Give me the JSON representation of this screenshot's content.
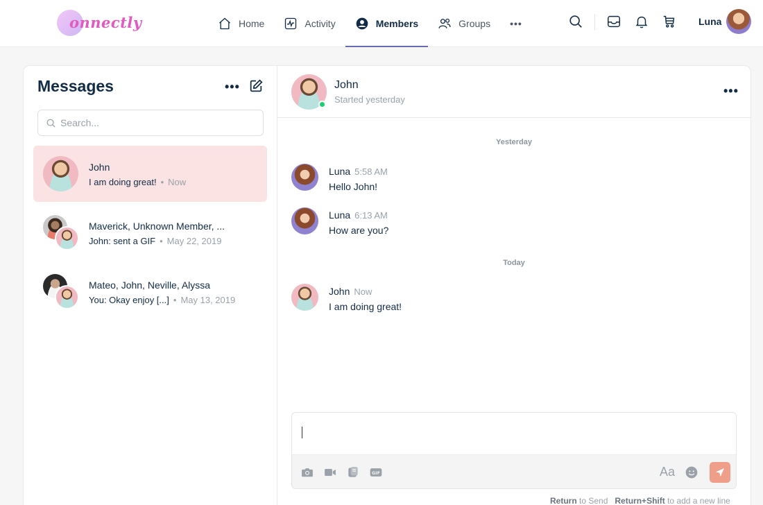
{
  "app": {
    "logo_text": "onnectly"
  },
  "nav": {
    "items": [
      {
        "label": "Home",
        "icon": "home-icon"
      },
      {
        "label": "Activity",
        "icon": "activity-icon"
      },
      {
        "label": "Members",
        "icon": "members-icon",
        "active": true
      },
      {
        "label": "Groups",
        "icon": "groups-icon"
      }
    ],
    "more": "•••"
  },
  "user": {
    "name": "Luna"
  },
  "messages_panel": {
    "title": "Messages",
    "more": "•••",
    "search_placeholder": "Search...",
    "threads": [
      {
        "name": "John",
        "last": "I am doing great!",
        "time": "Now",
        "active": true
      },
      {
        "name": "Maverick, Unknown Member, ...",
        "last": "John: sent a GIF",
        "time": "May 22, 2019"
      },
      {
        "name": "Mateo, John, Neville, Alyssa",
        "last": "You: Okay enjoy [...]",
        "time": "May 13, 2019"
      }
    ]
  },
  "chat": {
    "name": "John",
    "subtitle": "Started yesterday",
    "more": "•••",
    "day_yesterday": "Yesterday",
    "day_today": "Today",
    "messages": [
      {
        "sender": "Luna",
        "time": "5:58 AM",
        "text": "Hello John!"
      },
      {
        "sender": "Luna",
        "time": "6:13 AM",
        "text": "How are you?"
      },
      {
        "sender": "John",
        "time": "Now",
        "text": "I am doing great!"
      }
    ],
    "composer": {
      "value": "",
      "format_label": "Aa",
      "hint_return": "Return",
      "hint_send": " to Send",
      "hint_shift": "Return+Shift",
      "hint_newline": " to add a new line"
    }
  },
  "colors": {
    "accent": "#6a6bb2",
    "active_thread": "#fbe3e4",
    "online": "#1ccd71",
    "send": "#ef9f89",
    "logo": "#e05bbf"
  }
}
